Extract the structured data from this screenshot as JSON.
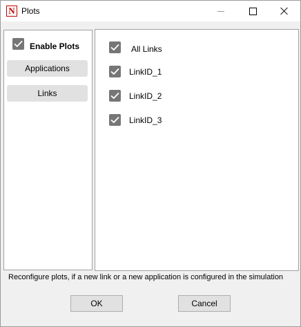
{
  "window": {
    "title": "Plots",
    "app_icon_letter": "N",
    "app_icon_color": "#c00000"
  },
  "sidebar": {
    "enable_plots": {
      "label": "Enable Plots",
      "checked": true
    },
    "buttons": [
      {
        "label": "Applications"
      },
      {
        "label": "Links"
      }
    ]
  },
  "links": [
    {
      "label": "All Links",
      "checked": true
    },
    {
      "label": "LinkID_1",
      "checked": true
    },
    {
      "label": "LinkID_2",
      "checked": true
    },
    {
      "label": "LinkID_3",
      "checked": true
    }
  ],
  "info_text": "Reconfigure plots, if a new link or a new application is configured in the simulation",
  "actions": {
    "ok_label": "OK",
    "cancel_label": "Cancel"
  },
  "colors": {
    "checkbox_fill": "#767676",
    "button_face": "#e1e1e1",
    "dialog_bg": "#f0f0f0"
  }
}
